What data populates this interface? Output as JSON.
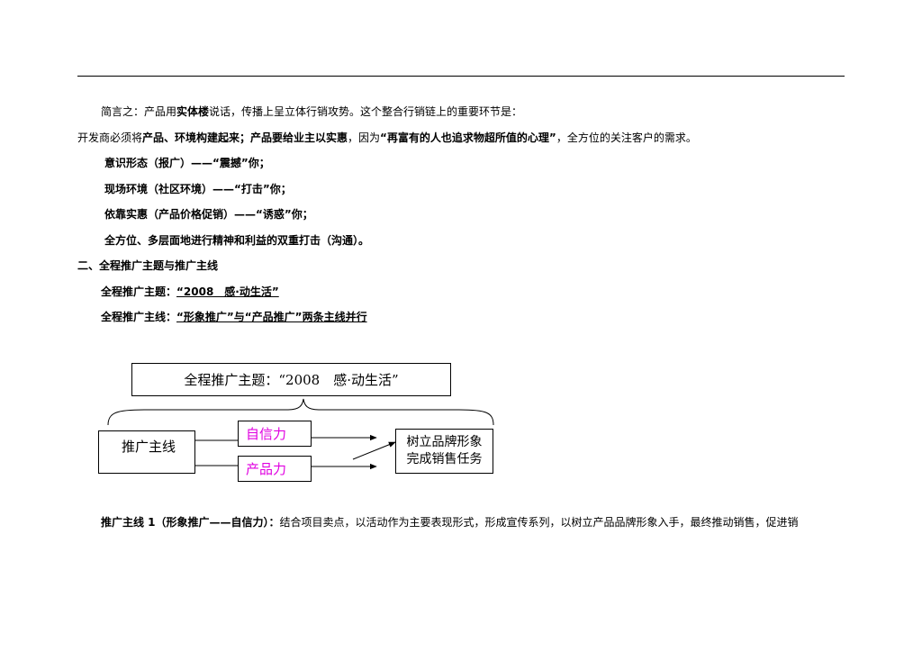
{
  "p1": {
    "a": "简言之：产品用",
    "b": "实体楼",
    "c": "说话，传播上呈立体行销攻势。这个整合行销链上的重要环节是："
  },
  "p2": {
    "a": "开发商必须将",
    "b": "产品、环境构建起来；产品要给业主以实惠",
    "c": "，因为",
    "d": "“再富有的人也追求物超所值的心理”",
    "e": "，全方位的关注客户的需求。"
  },
  "bullets": [
    "意识形态（报广）——“震撼”你；",
    "现场环境（社区环境）——“打击”你；",
    "依靠实惠（产品价格促销）——“诱惑”你；",
    "全方位、多层面地进行精神和利益的双重打击（沟通）。"
  ],
  "section2": {
    "heading": "二、全程推广主题与推广主线",
    "theme_label": "全程推广主题：",
    "theme_value": "“2008　感·动生活”",
    "line_label": "全程推广主线：",
    "line_value": "“形象推广”与“产品推广”两条主线并行"
  },
  "diagram": {
    "top": "全程推广主题：“2008　感·动生活”",
    "left": "推广主线",
    "mid_top": "自信力",
    "mid_bottom": "产品力",
    "right_1": "树立品牌形象",
    "right_2": "完成销售任务"
  },
  "p_last": {
    "a": "推广主线 1（形象推广——自信力）：",
    "b": "结合项目卖点，以活动作为主要表现形式，形成宣传系列，以树立产品品牌形象入手，最终推动销售，促进销"
  },
  "colors": {
    "accent": "#e000e0"
  }
}
